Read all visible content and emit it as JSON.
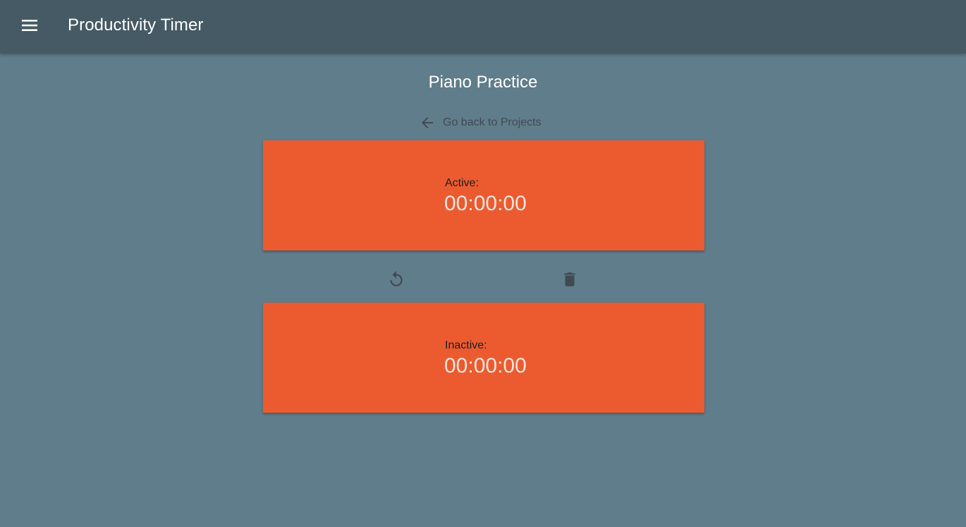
{
  "app_bar": {
    "title": "Productivity Timer",
    "menu_icon": "menu-icon",
    "background": "#455a64"
  },
  "page": {
    "title": "Piano Practice",
    "background": "#607d8b"
  },
  "back_link": {
    "label": "Go back to Projects",
    "icon": "arrow-left-icon"
  },
  "timers": {
    "active": {
      "label": "Active:",
      "time": "00:00:00"
    },
    "inactive": {
      "label": "Inactive:",
      "time": "00:00:00"
    },
    "card_color": "#eb5b2f"
  },
  "actions": {
    "reset_icon": "reset-icon",
    "delete_icon": "trash-icon"
  }
}
